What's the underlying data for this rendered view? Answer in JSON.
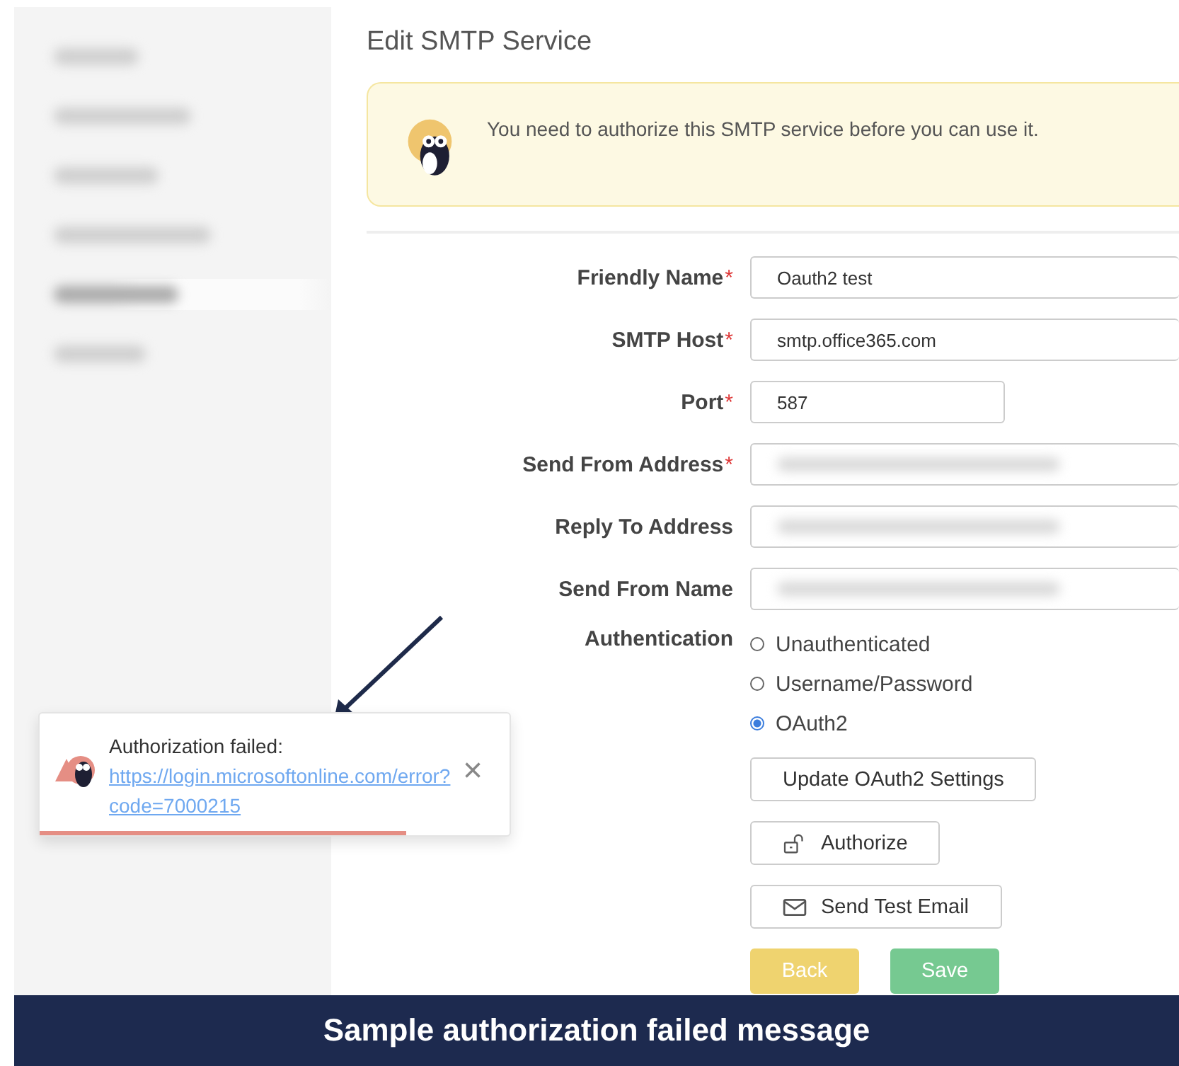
{
  "sidebar": {
    "items": [
      {
        "selected": false
      },
      {
        "selected": false
      },
      {
        "selected": false
      },
      {
        "selected": false
      },
      {
        "selected": true
      },
      {
        "selected": false
      }
    ]
  },
  "page": {
    "title": "Edit SMTP Service"
  },
  "notice": {
    "text": "You need to authorize this SMTP service before you can use it."
  },
  "form": {
    "fields": [
      {
        "label": "Friendly Name",
        "required_mark": "*",
        "value": "Oauth2 test",
        "kind": "long",
        "blurred": false
      },
      {
        "label": "SMTP Host",
        "required_mark": "*",
        "value": "smtp.office365.com",
        "kind": "long",
        "blurred": false
      },
      {
        "label": "Port",
        "required_mark": "*",
        "value": "587",
        "kind": "short",
        "blurred": false
      },
      {
        "label": "Send From Address",
        "required_mark": "*",
        "kind": "long",
        "blurred": true
      },
      {
        "label": "Reply To Address",
        "kind": "long",
        "blurred": true
      },
      {
        "label": "Send From Name",
        "kind": "long",
        "blurred": true
      }
    ],
    "authentication": {
      "label": "Authentication",
      "options": [
        {
          "label": "Unauthenticated",
          "selected": false
        },
        {
          "label": "Username/Password",
          "selected": false
        },
        {
          "label": "OAuth2",
          "selected": true
        }
      ]
    },
    "buttons": [
      {
        "label": "Update OAuth2 Settings",
        "kind": "plain"
      },
      {
        "label": "Authorize",
        "kind": "lock"
      },
      {
        "label": "Send Test Email",
        "kind": "mail"
      }
    ],
    "actions": [
      {
        "label": "Back",
        "kind": "back"
      },
      {
        "label": "Save",
        "kind": "save"
      }
    ]
  },
  "toast": {
    "title": "Authorization failed:",
    "link": "https://login.microsoftonline.com/error?code=7000215",
    "close": "×",
    "level": 0.78
  },
  "caption": "Sample authorization failed message"
}
